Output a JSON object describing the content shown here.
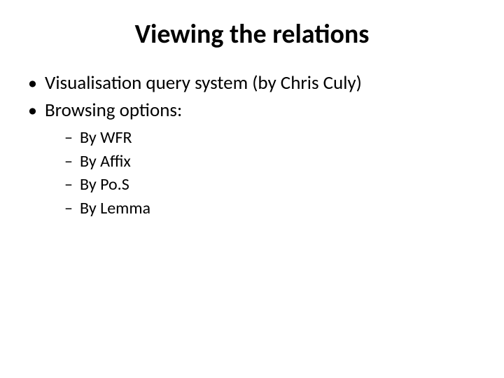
{
  "title": "Viewing the relations",
  "bullets": [
    {
      "text": "Visualisation query system (by Chris Culy)"
    },
    {
      "text": "Browsing options:"
    }
  ],
  "subbullets": [
    {
      "text": "By WFR"
    },
    {
      "text": "By Affix"
    },
    {
      "text": "By Po.S"
    },
    {
      "text": "By Lemma"
    }
  ]
}
